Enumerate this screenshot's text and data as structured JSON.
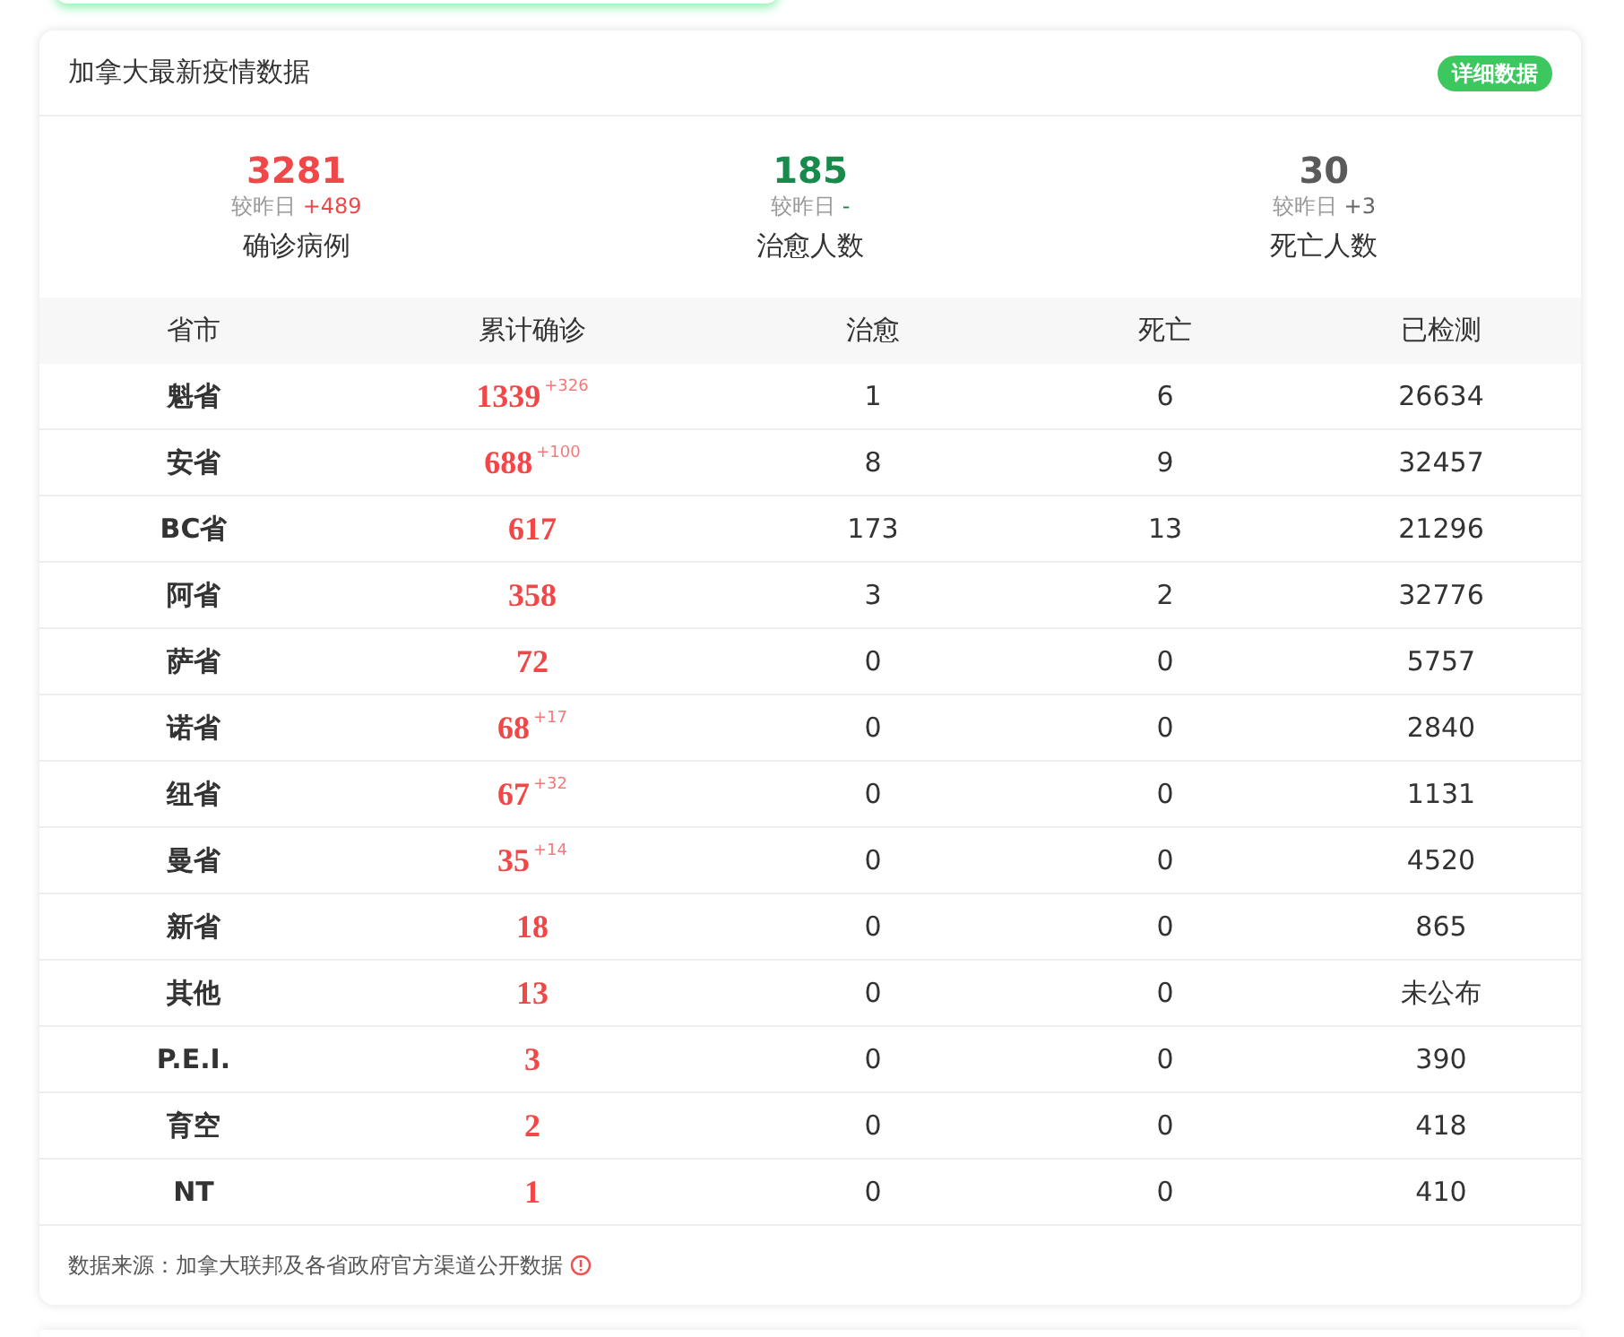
{
  "header": {
    "title": "加拿大最新疫情数据",
    "detail_button": "详细数据"
  },
  "summary": [
    {
      "kind": "confirmed",
      "value": "3281",
      "compare_label": "较昨日",
      "change": "+489",
      "label": "确诊病例"
    },
    {
      "kind": "recovered",
      "value": "185",
      "compare_label": "较昨日",
      "change": "-",
      "label": "治愈人数"
    },
    {
      "kind": "deaths",
      "value": "30",
      "compare_label": "较昨日",
      "change": "+3",
      "label": "死亡人数"
    }
  ],
  "table": {
    "columns": [
      "省市",
      "累计确诊",
      "治愈",
      "死亡",
      "已检测"
    ],
    "rows": [
      {
        "province": "魁省",
        "confirmed": "1339",
        "new": "+326",
        "recovered": "1",
        "deaths": "6",
        "tested": "26634"
      },
      {
        "province": "安省",
        "confirmed": "688",
        "new": "+100",
        "recovered": "8",
        "deaths": "9",
        "tested": "32457"
      },
      {
        "province": "BC省",
        "confirmed": "617",
        "recovered": "173",
        "deaths": "13",
        "tested": "21296"
      },
      {
        "province": "阿省",
        "confirmed": "358",
        "recovered": "3",
        "deaths": "2",
        "tested": "32776"
      },
      {
        "province": "萨省",
        "confirmed": "72",
        "recovered": "0",
        "deaths": "0",
        "tested": "5757"
      },
      {
        "province": "诺省",
        "confirmed": "68",
        "new": "+17",
        "recovered": "0",
        "deaths": "0",
        "tested": "2840"
      },
      {
        "province": "纽省",
        "confirmed": "67",
        "new": "+32",
        "recovered": "0",
        "deaths": "0",
        "tested": "1131"
      },
      {
        "province": "曼省",
        "confirmed": "35",
        "new": "+14",
        "recovered": "0",
        "deaths": "0",
        "tested": "4520"
      },
      {
        "province": "新省",
        "confirmed": "18",
        "recovered": "0",
        "deaths": "0",
        "tested": "865"
      },
      {
        "province": "其他",
        "confirmed": "13",
        "recovered": "0",
        "deaths": "0",
        "tested": "未公布"
      },
      {
        "province": "P.E.I.",
        "confirmed": "3",
        "recovered": "0",
        "deaths": "0",
        "tested": "390"
      },
      {
        "province": "育空",
        "confirmed": "2",
        "recovered": "0",
        "deaths": "0",
        "tested": "418"
      },
      {
        "province": "NT",
        "confirmed": "1",
        "recovered": "0",
        "deaths": "0",
        "tested": "410"
      }
    ]
  },
  "footer": {
    "source": "数据来源：加拿大联邦及各省政府官方渠道公开数据"
  }
}
